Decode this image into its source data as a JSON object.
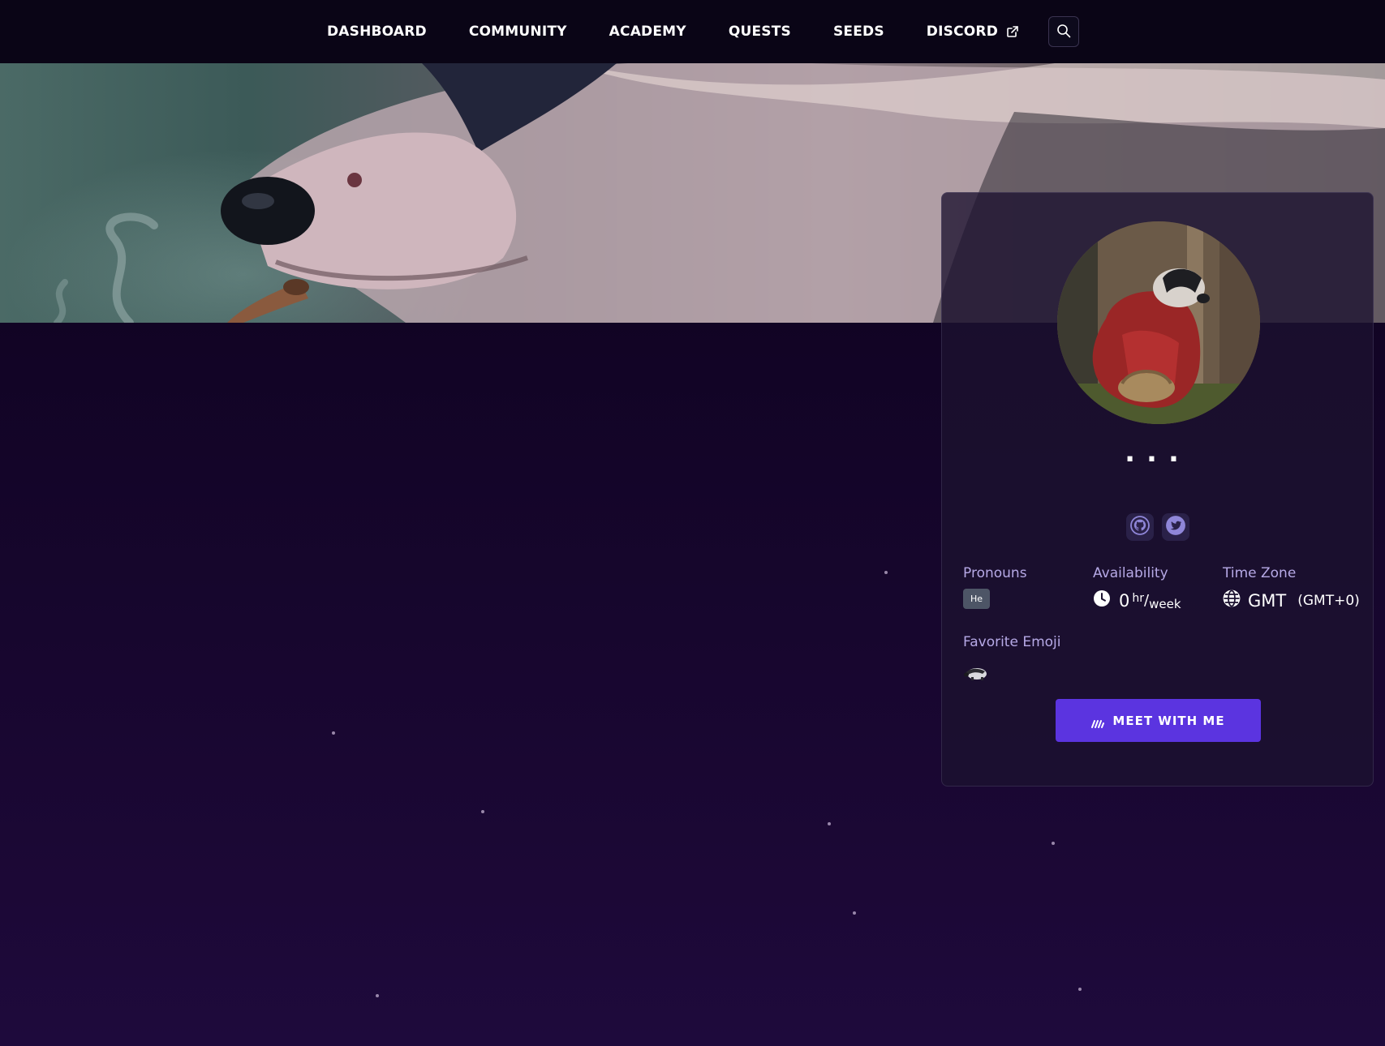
{
  "nav": {
    "items": [
      {
        "label": "DASHBOARD"
      },
      {
        "label": "COMMUNITY"
      },
      {
        "label": "ACADEMY"
      },
      {
        "label": "QUESTS"
      },
      {
        "label": "SEEDS"
      },
      {
        "label": "DISCORD"
      }
    ],
    "discord_icon": "external-link-icon",
    "search_icon": "search-icon"
  },
  "profile": {
    "name_placeholder": "...",
    "socials": [
      {
        "icon": "github-icon"
      },
      {
        "icon": "twitter-icon"
      }
    ],
    "pronouns": {
      "label": "Pronouns",
      "value": "He"
    },
    "availability": {
      "label": "Availability",
      "hours": "0",
      "unit_top": "hr",
      "unit_slash": "/",
      "unit_bottom": "week",
      "icon": "clock-icon"
    },
    "timezone": {
      "label": "Time Zone",
      "name": "GMT",
      "offset": "(GMT+0)",
      "icon": "globe-icon"
    },
    "favorite_emoji": {
      "label": "Favorite Emoji",
      "icon": "badger-emoji-icon"
    },
    "meet_button": {
      "label": "MEET WITH ME",
      "icon": "calendar-link-icon"
    }
  },
  "colors": {
    "accent": "#5b34e0",
    "label": "#b6a9e6",
    "background": "#110424"
  }
}
